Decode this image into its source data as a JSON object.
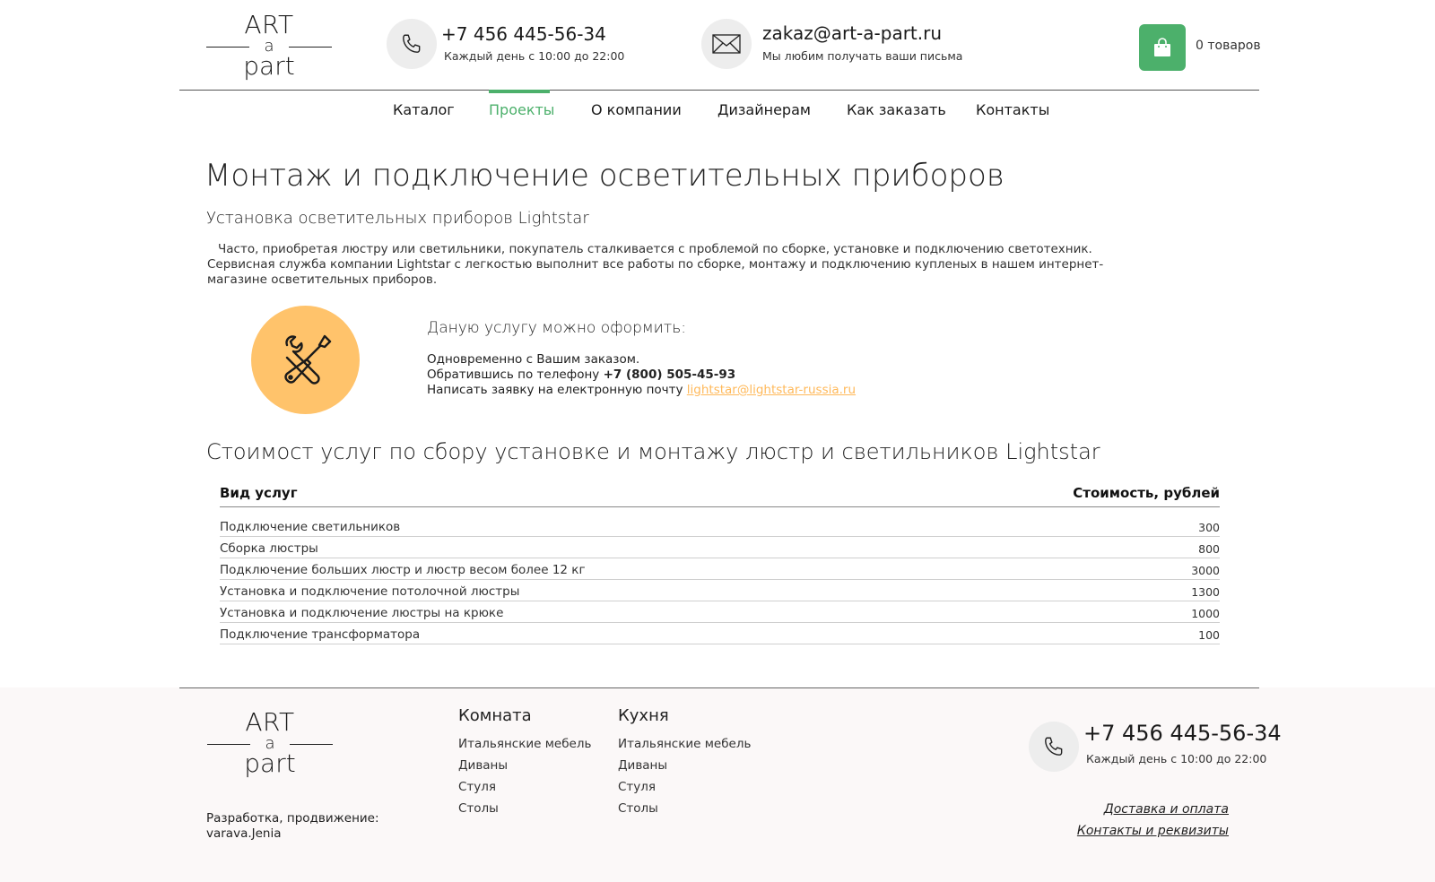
{
  "header": {
    "logo": {
      "line1": "ART",
      "line2": "a",
      "line3": "part"
    },
    "phone": {
      "number": "+7 456 445-56-34",
      "hours": "Каждый день с 10:00 до 22:00",
      "icon": "phone-icon"
    },
    "email": {
      "address": "zakaz@art-a-part.ru",
      "note": "Мы любим получать ваши письма",
      "icon": "envelope-icon"
    },
    "cart": {
      "label": "0 товаров",
      "icon": "shopping-bag-icon",
      "color": "#4cb06b"
    }
  },
  "nav": {
    "items": [
      "Каталог",
      "Проекты",
      "О компании",
      "Дизайнерам",
      "Как заказать",
      "Контакты"
    ],
    "active": "Проекты",
    "accent": "#4cb06b"
  },
  "main": {
    "title": "Монтаж и подключение осветительных приборов",
    "subtitle": "Установка осветительных приборов Lightstar",
    "intro": "Часто, приобретая люстру или светильники, покупатель сталкивается с проблемой по сборке, установке и подключению светотехник. Сервисная служба компании Lightstar с легкостью выполнит все работы по сборке, монтажу и подключению купленых в нашем интернет-магазине осветительных приборов.",
    "service": {
      "icon": "tools-icon",
      "icon_color": "#ffc36b",
      "title": "Даную услугу можно оформить:",
      "line1": "Одновременно с Вашим заказом.",
      "line2_prefix": "Обратившись по телефону",
      "line2_phone": "+7 (800) 505-45-93",
      "line3_prefix": "Написать заявку на електронную почту",
      "line3_email": "lightstar@lightstar-russia.ru"
    },
    "pricing": {
      "title": "Стоимост услуг по сбору установке и монтажу люстр и светильников Lightstar",
      "col_service": "Вид услуг",
      "col_price": "Стоимость, рублей",
      "rows": [
        {
          "name": "Подключение светильников",
          "price": "300"
        },
        {
          "name": "Сборка люстры",
          "price": "800"
        },
        {
          "name": "Подключение больших люстр и люстр весом более 12 кг",
          "price": "3000"
        },
        {
          "name": "Установка и подключение потолочной люстры",
          "price": "1300"
        },
        {
          "name": "Установка и подключение люстры на крюке",
          "price": "1000"
        },
        {
          "name": "Подключение трансформатора",
          "price": "100"
        }
      ]
    }
  },
  "footer": {
    "logo": {
      "line1": "ART",
      "line2": "a",
      "line3": "part"
    },
    "dev_label": "Разработка, продвижение:",
    "dev_name": "varava.Jenia",
    "col1": {
      "title": "Комната",
      "links": [
        "Итальянские мебель",
        "Диваны",
        "Стуля",
        "Столы"
      ]
    },
    "col2": {
      "title": "Кухня",
      "links": [
        "Итальянские мебель",
        "Диваны",
        "Стуля",
        "Столы"
      ]
    },
    "phone": {
      "number": "+7 456 445-56-34",
      "hours": "Каждый день с 10:00 до 22:00"
    },
    "links": [
      "Доставка и оплата",
      "Контакты и реквизиты"
    ]
  }
}
